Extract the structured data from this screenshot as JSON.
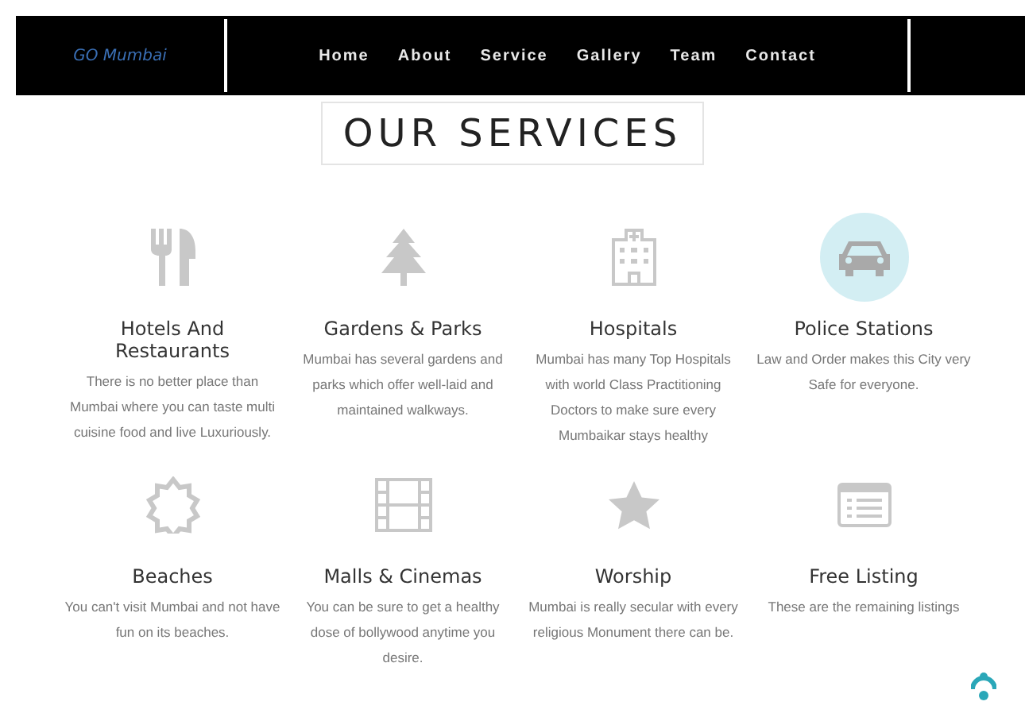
{
  "nav": {
    "logo": "GO Mumbai",
    "links": [
      {
        "label": "Home"
      },
      {
        "label": "About"
      },
      {
        "label": "Service"
      },
      {
        "label": "Gallery"
      },
      {
        "label": "Team"
      },
      {
        "label": "Contact"
      }
    ]
  },
  "heading": "OUR SERVICES",
  "services": [
    {
      "title": "Hotels And Restaurants",
      "text": "There is no better place than Mumbai where you can taste multi cuisine food and live Luxuriously.",
      "highlighted": false
    },
    {
      "title": "Gardens & Parks",
      "text": "Mumbai has several gardens and parks which offer well-laid and maintained walkways.",
      "highlighted": false
    },
    {
      "title": "Hospitals",
      "text": "Mumbai has many Top Hospitals with world Class Practitioning Doctors to make sure every Mumbaikar stays healthy",
      "highlighted": false
    },
    {
      "title": "Police Stations",
      "text": "Law and Order makes this City very Safe for everyone.",
      "highlighted": true
    },
    {
      "title": "Beaches",
      "text": "You can't visit Mumbai and not have fun on its beaches.",
      "highlighted": false
    },
    {
      "title": "Malls & Cinemas",
      "text": "You can be sure to get a healthy dose of bollywood anytime you desire.",
      "highlighted": false
    },
    {
      "title": "Worship",
      "text": "Mumbai is really secular with every religious Monument there can be.",
      "highlighted": false
    },
    {
      "title": "Free Listing",
      "text": "These are the remaining listings",
      "highlighted": false
    }
  ]
}
